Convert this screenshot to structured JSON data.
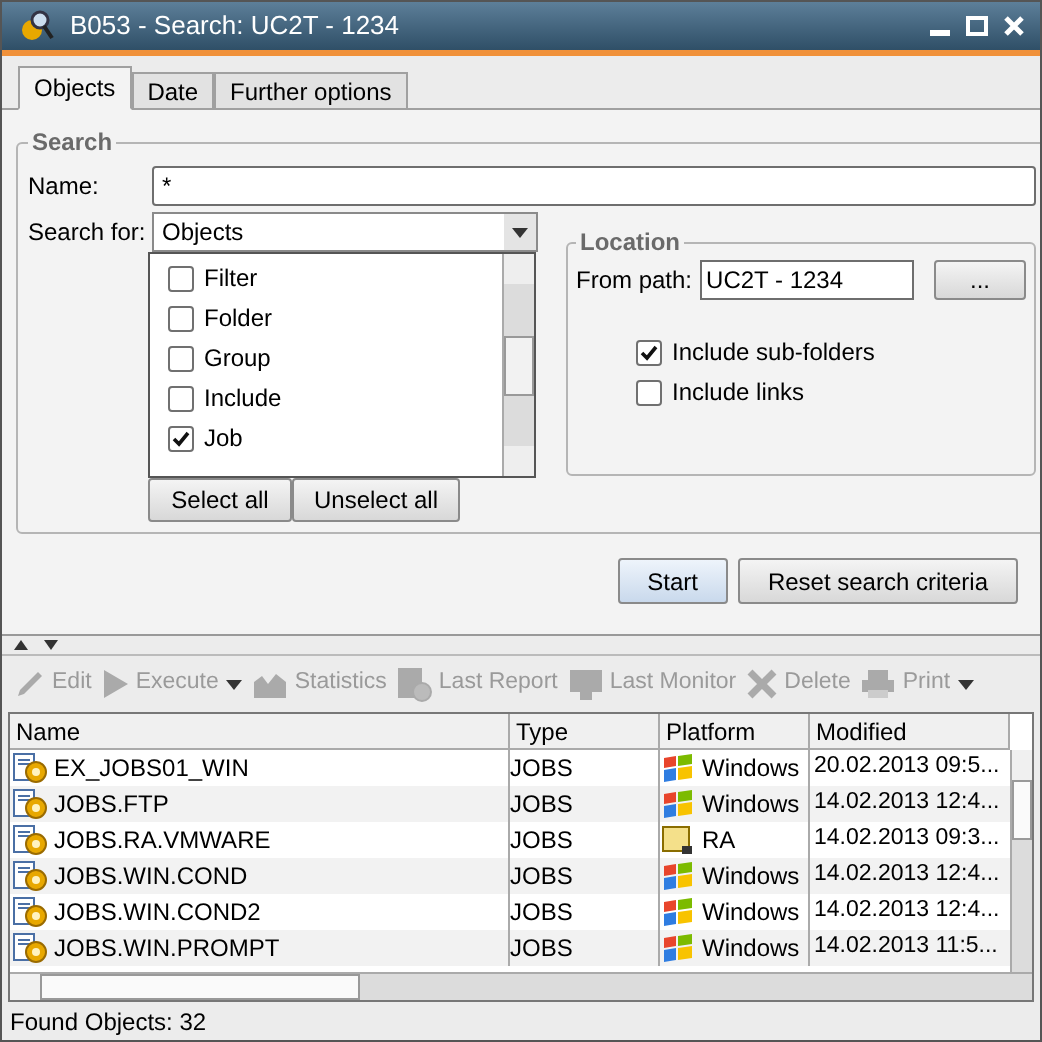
{
  "window": {
    "title": "B053 - Search: UC2T - 1234"
  },
  "tabs": [
    {
      "label": "Objects",
      "selected": true
    },
    {
      "label": "Date",
      "selected": false
    },
    {
      "label": "Further options",
      "selected": false
    }
  ],
  "search": {
    "title": "Search",
    "name_label": "Name:",
    "name_value": "*",
    "search_for_label": "Search for:",
    "search_for_value": "Objects",
    "types": [
      {
        "label": "Filter",
        "checked": false
      },
      {
        "label": "Folder",
        "checked": false
      },
      {
        "label": "Group",
        "checked": false
      },
      {
        "label": "Include",
        "checked": false
      },
      {
        "label": "Job",
        "checked": true
      }
    ],
    "select_all": "Select all",
    "unselect_all": "Unselect all"
  },
  "location": {
    "title": "Location",
    "path_label": "From path:",
    "path_value": "UC2T - 1234",
    "browse": "...",
    "options": [
      {
        "label": "Include sub-folders",
        "checked": true
      },
      {
        "label": "Include links",
        "checked": false
      }
    ]
  },
  "actions": [
    {
      "label": "Start",
      "selected": true
    },
    {
      "label": "Reset search criteria",
      "selected": false
    }
  ],
  "toolbar": [
    {
      "kind": "edit",
      "label": "Edit",
      "disabled": true,
      "dropdown": false
    },
    {
      "kind": "execute",
      "label": "Execute",
      "disabled": true,
      "dropdown": true
    },
    {
      "kind": "statistics",
      "label": "Statistics",
      "disabled": true,
      "dropdown": false
    },
    {
      "kind": "report",
      "label": "Last Report",
      "disabled": true,
      "dropdown": false
    },
    {
      "kind": "monitor",
      "label": "Last Monitor",
      "disabled": true,
      "dropdown": false
    },
    {
      "kind": "delete",
      "label": "Delete",
      "disabled": true,
      "dropdown": false
    },
    {
      "kind": "print",
      "label": "Print",
      "disabled": true,
      "dropdown": true
    }
  ],
  "table": {
    "columns": [
      "Name",
      "Type",
      "Platform",
      "Modified"
    ],
    "rows": [
      {
        "name": "EX_JOBS01_WIN",
        "type": "JOBS",
        "platform": {
          "kind": "windows",
          "label": "Windows"
        },
        "modified": "20.02.2013 09:5..."
      },
      {
        "name": "JOBS.FTP",
        "type": "JOBS",
        "platform": {
          "kind": "windows",
          "label": "Windows"
        },
        "modified": "14.02.2013 12:4..."
      },
      {
        "name": "JOBS.RA.VMWARE",
        "type": "JOBS",
        "platform": {
          "kind": "ra",
          "label": "RA"
        },
        "modified": "14.02.2013 09:3..."
      },
      {
        "name": "JOBS.WIN.COND",
        "type": "JOBS",
        "platform": {
          "kind": "windows",
          "label": "Windows"
        },
        "modified": "14.02.2013 12:4..."
      },
      {
        "name": "JOBS.WIN.COND2",
        "type": "JOBS",
        "platform": {
          "kind": "windows",
          "label": "Windows"
        },
        "modified": "14.02.2013 12:4..."
      },
      {
        "name": "JOBS.WIN.PROMPT",
        "type": "JOBS",
        "platform": {
          "kind": "windows",
          "label": "Windows"
        },
        "modified": "14.02.2013 11:5..."
      }
    ]
  },
  "status_bar": "Found Objects: 32"
}
